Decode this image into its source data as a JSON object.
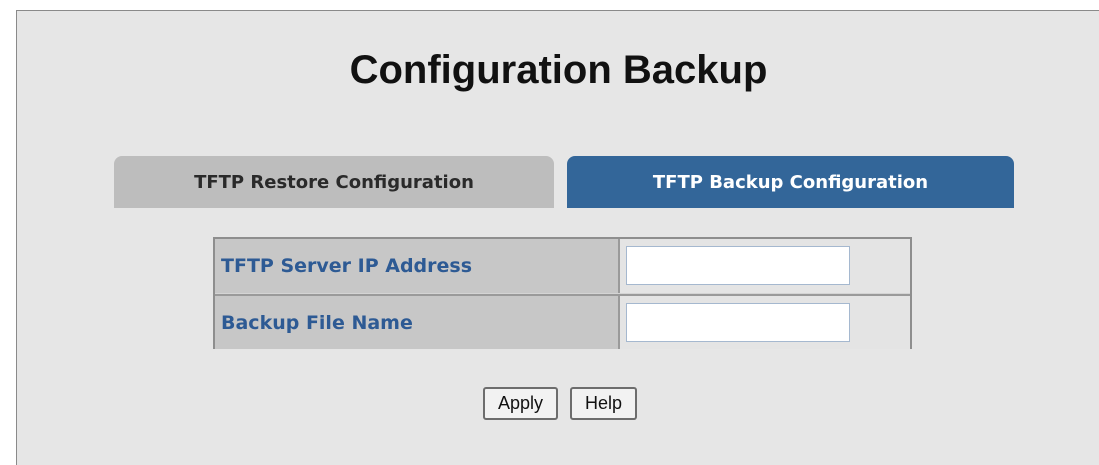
{
  "page": {
    "title": "Configuration Backup"
  },
  "tabs": [
    {
      "label": "TFTP Restore Configuration",
      "active": false
    },
    {
      "label": "TFTP Backup Configuration",
      "active": true
    }
  ],
  "form": {
    "fields": [
      {
        "label": "TFTP Server IP Address",
        "value": "",
        "placeholder": ""
      },
      {
        "label": "Backup File Name",
        "value": "",
        "placeholder": ""
      }
    ]
  },
  "buttons": {
    "apply_label": "Apply",
    "help_label": "Help"
  },
  "colors": {
    "active_tab": "#336699",
    "inactive_tab": "#bdbdbd",
    "field_label_text": "#2d5a94",
    "panel_background": "#e6e6e6"
  }
}
